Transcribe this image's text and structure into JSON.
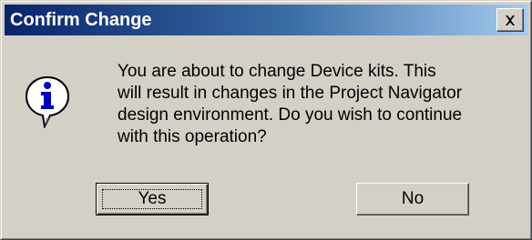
{
  "window": {
    "title": "Confirm Change",
    "close_icon": "close-x-icon"
  },
  "dialog": {
    "icon": "information-icon",
    "message": "You are about to change Device kits.  This\nwill result in changes in the Project Navigator\ndesign environment.  Do you wish to continue\nwith this operation?"
  },
  "buttons": {
    "yes_label": "Yes",
    "no_label": "No",
    "focused": "Yes"
  },
  "colors": {
    "titlebar_start": "#0a246a",
    "titlebar_end": "#a6caf0",
    "dialog_face": "#d4d0c8",
    "icon_fill": "#0000c0"
  }
}
